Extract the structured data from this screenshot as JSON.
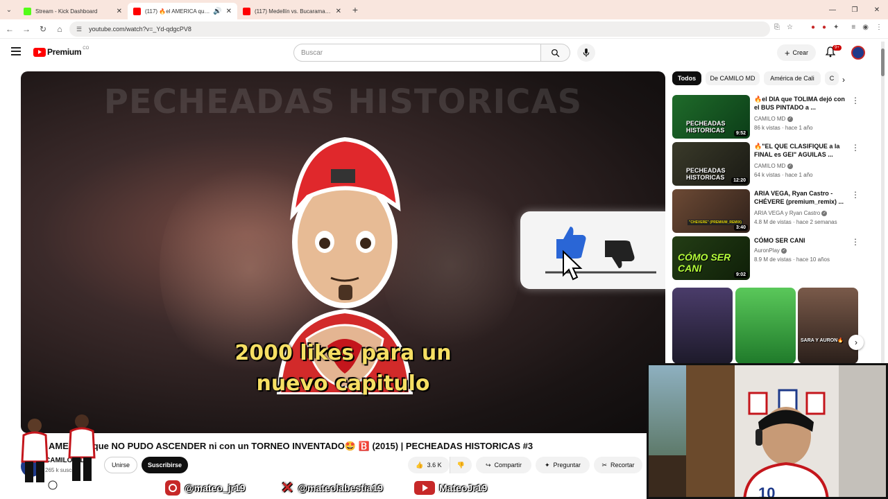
{
  "browser": {
    "tabs": [
      {
        "title": "Stream - Kick Dashboard",
        "active": false
      },
      {
        "title": "(117) 🔥el AMERICA que NO PUDO ASCENDER",
        "active": true
      },
      {
        "title": "(117) Medellín vs. Bucaramanga",
        "active": false
      }
    ],
    "new_tab": "+",
    "url": "youtube.com/watch?v=_Yd-qdgcPV8"
  },
  "youtube": {
    "logo_text": "Premium",
    "country": "CO",
    "search_placeholder": "Buscar",
    "crear_label": "Crear",
    "notif_count": "9+"
  },
  "video": {
    "overlay_title": "PECHEADAS HISTORICAS",
    "likes_line1": "2000 likes para un",
    "likes_line2": "nuevo capitulo",
    "title": "AMERICA que NO PUDO ASCENDER ni con un TORNEO INVENTADO🤩 🅱️ (2015) | PECHEADAS HISTORICAS #3",
    "channel": "CAMILO MD",
    "subs": "265 k suscr...",
    "join_label": "Unirse",
    "subscribe_label": "Suscribirse",
    "like_count": "3.6 K",
    "share_label": "Compartir",
    "ask_label": "Preguntar",
    "clip_label": "Recortar"
  },
  "sidebar": {
    "chips": [
      "Todos",
      "De CAMILO MD",
      "América de Cali",
      "C"
    ],
    "recs": [
      {
        "title": "🔥el DIA que TOLIMA dejó con el BUS PINTADO a ...",
        "channel": "CAMILO MD",
        "meta": "86 k vistas · hace 1 año",
        "duration": "9:52",
        "thumb_text": "PECHEADAS HISTORICAS"
      },
      {
        "title": "🔥\"EL QUE CLASIFIQUE a la FINAL es GEI\" AGUILAS ...",
        "channel": "CAMILO MD",
        "meta": "64 k vistas · hace 1 año",
        "duration": "12:20",
        "thumb_text": "PECHEADAS HISTORICAS"
      },
      {
        "title": "ARIA VEGA, Ryan Castro - CHÉVERE (premium_remix) ...",
        "channel": "ARIA VEGA y Ryan Castro",
        "meta": "4.8 M de vistas · hace 2 semanas",
        "duration": "3:40",
        "thumb_text": "\"CHEVERE\" (PREMIUM_REMIX)"
      },
      {
        "title": "CÓMO SER CANI",
        "channel": "AuronPlay",
        "meta": "8.9 M de vistas · hace 10 años",
        "duration": "9:02",
        "thumb_text": "CÓMO SER CANI"
      }
    ],
    "shorts_caption": "SARA Y AURON🔥"
  },
  "overlay": {
    "instagram": "@mateo_jr19",
    "x": "@mateolabestia19",
    "youtube": "MateoJr19"
  },
  "colors": {
    "yt_red": "#ff0000",
    "likes_yellow": "#f6df63",
    "tab_bg": "#f9e6de"
  }
}
